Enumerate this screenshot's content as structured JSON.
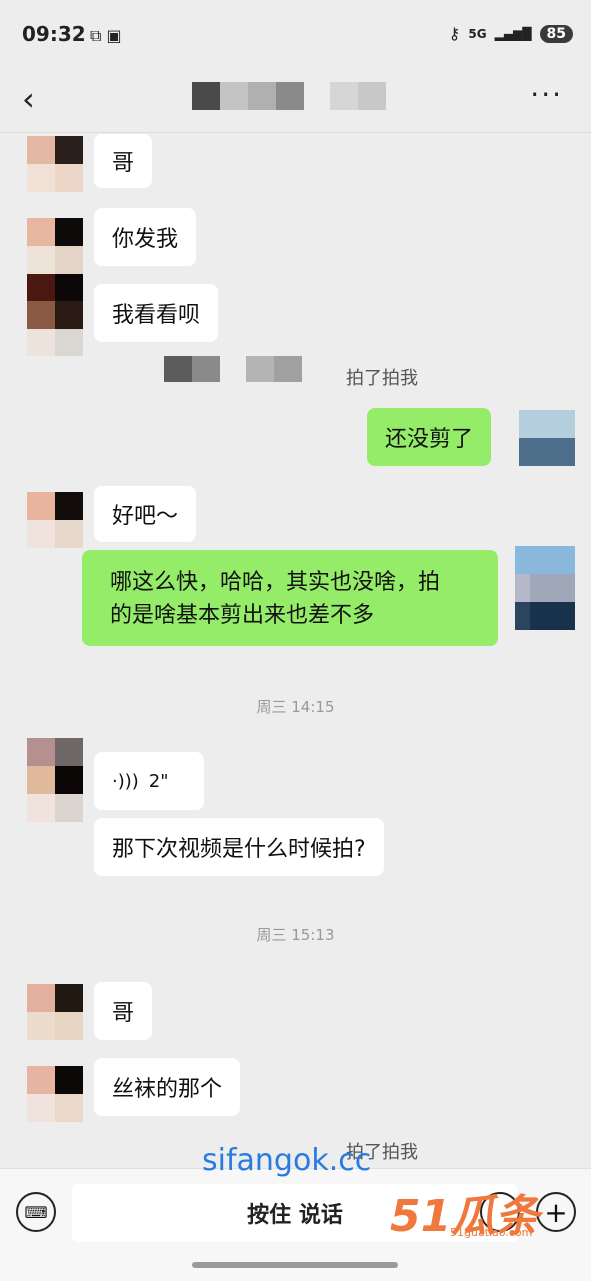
{
  "status_bar": {
    "time": "09:32",
    "signal": "5G",
    "battery": "85"
  },
  "header": {
    "more_label": "···",
    "back_label": "‹"
  },
  "messages": {
    "m1": "哥",
    "m2": "你发我",
    "m3": "我看看呗",
    "pat1": "拍了拍我",
    "m4": "还没剪了",
    "m5": "好吧～",
    "m6_line1": "哪这么快，哈哈，其实也没啥，拍",
    "m6_line2": "的是啥基本剪出来也差不多",
    "voice_duration": "2\"",
    "m7": "那下次视频是什么时候拍?",
    "m8": "哥",
    "m9": "丝袜的那个",
    "pat2": "拍了拍我"
  },
  "time_separators": {
    "t1": "周三 14:15",
    "t2": "周三 15:13"
  },
  "input_bar": {
    "talk_label": "按住 说话"
  },
  "watermarks": {
    "site": "sifangok.cc",
    "logo": "51瓜条",
    "logo_url": "51guatiao.com"
  },
  "colors": {
    "sent_bubble": "#95ec69",
    "received_bubble": "#ffffff",
    "background": "#ededed"
  }
}
